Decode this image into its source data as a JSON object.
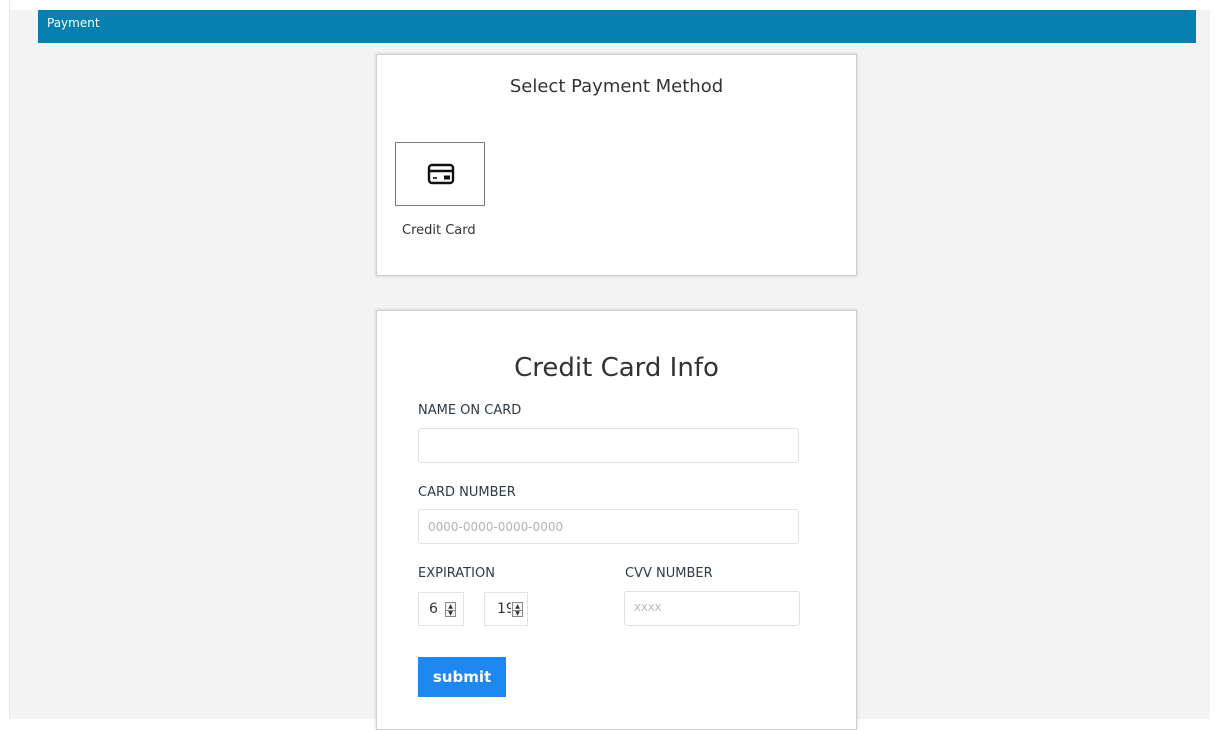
{
  "header": {
    "title": "Payment"
  },
  "payment_method": {
    "title": "Select Payment Method",
    "options": [
      {
        "label": "Credit Card",
        "icon": "credit-card-icon"
      }
    ]
  },
  "card_info": {
    "title": "Credit Card Info",
    "name_label": "NAME ON CARD",
    "name_value": "",
    "number_label": "CARD NUMBER",
    "number_placeholder": "0000-0000-0000-0000",
    "expiration_label": "EXPIRATION",
    "exp_month": "6",
    "exp_year": "19",
    "cvv_label": "CVV NUMBER",
    "cvv_placeholder": "XXXX",
    "submit_label": "submit"
  },
  "colors": {
    "header_bg": "#0680b1",
    "submit_bg": "#1e87f0",
    "page_bg": "#f3f3f3"
  }
}
